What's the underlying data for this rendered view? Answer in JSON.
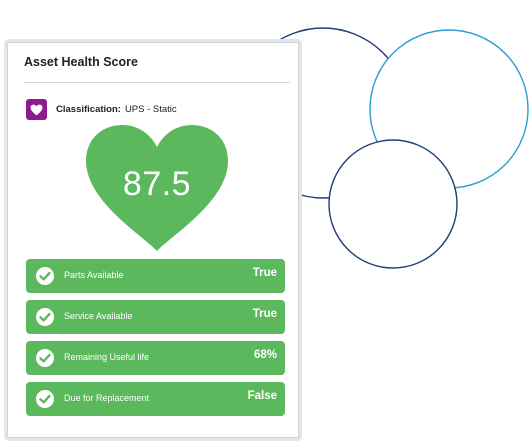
{
  "card": {
    "title": "Asset Health Score",
    "classification_label": "Classification:",
    "classification_value": "UPS - Static",
    "score": "87.5",
    "score_color": "#5cb85c",
    "badge_color": "#8e1a8e"
  },
  "metrics": [
    {
      "label": "Parts Available",
      "value": "True",
      "icon": "check-circle-icon"
    },
    {
      "label": "Service Available",
      "value": "True",
      "icon": "check-circle-icon"
    },
    {
      "label": "Remaining Useful life",
      "value": "68%",
      "icon": "check-circle-icon"
    },
    {
      "label": "Due for Replacement",
      "value": "False",
      "icon": "check-circle-icon"
    }
  ]
}
